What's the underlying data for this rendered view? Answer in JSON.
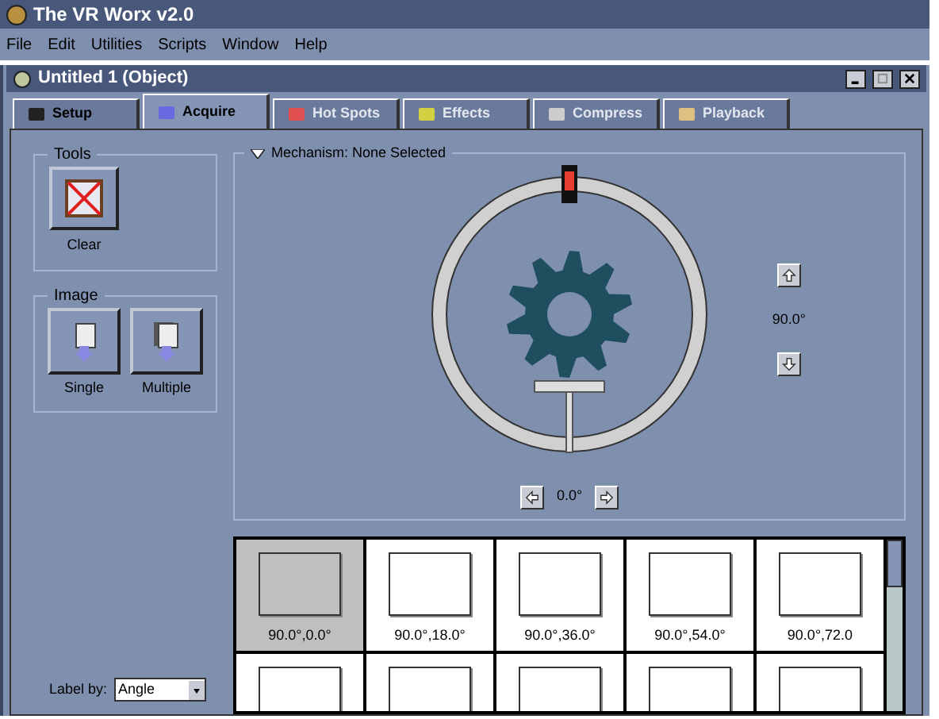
{
  "app": {
    "title": "The VR Worx v2.0"
  },
  "menu": [
    "File",
    "Edit",
    "Utilities",
    "Scripts",
    "Window",
    "Help"
  ],
  "document": {
    "title": "Untitled 1 (Object)"
  },
  "tabs": [
    {
      "label": "Setup",
      "selected": false,
      "disabled": false
    },
    {
      "label": "Acquire",
      "selected": true,
      "disabled": false
    },
    {
      "label": "Hot Spots",
      "selected": false,
      "disabled": true
    },
    {
      "label": "Effects",
      "selected": false,
      "disabled": true
    },
    {
      "label": "Compress",
      "selected": false,
      "disabled": true
    },
    {
      "label": "Playback",
      "selected": false,
      "disabled": true
    }
  ],
  "tools": {
    "title": "Tools",
    "buttons": [
      {
        "label": "Clear"
      }
    ]
  },
  "image": {
    "title": "Image",
    "buttons": [
      {
        "label": "Single"
      },
      {
        "label": "Multiple"
      }
    ]
  },
  "mechanism": {
    "title": "Mechanism: None Selected",
    "vertical_angle": "90.0°",
    "horizontal_angle": "0.0°"
  },
  "thumbnails": [
    {
      "label": "90.0°,0.0°",
      "selected": true
    },
    {
      "label": "90.0°,18.0°",
      "selected": false
    },
    {
      "label": "90.0°,36.0°",
      "selected": false
    },
    {
      "label": "90.0°,54.0°",
      "selected": false
    },
    {
      "label": "90.0°,72.0",
      "selected": false
    }
  ],
  "thumbnails_row_2": [
    {
      "selected": false
    },
    {
      "selected": false
    },
    {
      "selected": false
    },
    {
      "selected": false
    },
    {
      "selected": false
    }
  ],
  "label_by": {
    "label": "Label by:",
    "value": "Angle"
  }
}
